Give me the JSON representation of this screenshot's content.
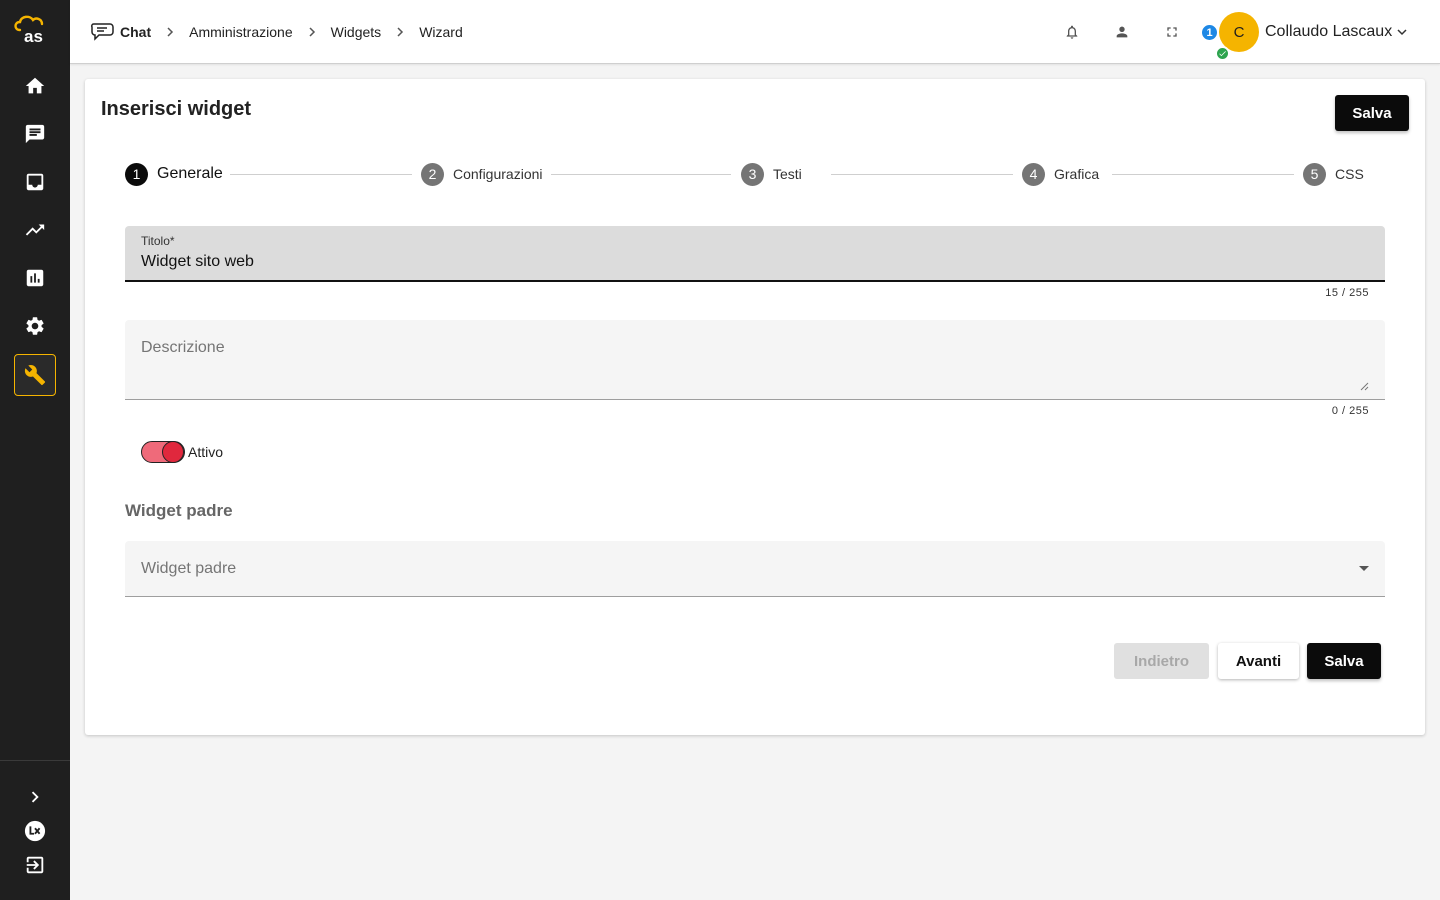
{
  "app": {
    "logo_text": "as",
    "brand_color": "#f5b400",
    "sidebar_bg": "#1f1f1f"
  },
  "sidebar": {
    "items": [
      {
        "icon": "home-icon",
        "active": false
      },
      {
        "icon": "chat-bubble-icon",
        "active": false
      },
      {
        "icon": "inbox-icon",
        "active": false
      },
      {
        "icon": "trending-up-icon",
        "active": false
      },
      {
        "icon": "bar-chart-icon",
        "active": false
      },
      {
        "icon": "gear-icon",
        "active": false
      },
      {
        "icon": "wrench-icon",
        "active": true
      }
    ],
    "bottom": [
      {
        "icon": "chevron-right-icon"
      },
      {
        "icon": "lx-logo-icon"
      },
      {
        "icon": "logout-icon"
      }
    ]
  },
  "breadcrumb": {
    "items": [
      "Chat",
      "Amministrazione",
      "Widgets",
      "Wizard"
    ]
  },
  "header": {
    "user_count": "1",
    "avatar_initial": "C",
    "user_name": "Collaudo Lascaux"
  },
  "card": {
    "title": "Inserisci widget",
    "save_label": "Salva"
  },
  "stepper": {
    "steps": [
      {
        "num": "1",
        "label": "Generale",
        "active": true
      },
      {
        "num": "2",
        "label": "Configurazioni",
        "active": false
      },
      {
        "num": "3",
        "label": "Testi",
        "active": false
      },
      {
        "num": "4",
        "label": "Grafica",
        "active": false
      },
      {
        "num": "5",
        "label": "CSS",
        "active": false
      }
    ]
  },
  "form": {
    "title_label": "Titolo*",
    "title_value": "Widget sito web",
    "title_counter": "15 / 255",
    "description_placeholder": "Descrizione",
    "description_counter": "0 / 255",
    "active_label": "Attivo",
    "active_on": true,
    "parent_section": "Widget padre",
    "parent_placeholder": "Widget padre"
  },
  "actions": {
    "back_label": "Indietro",
    "next_label": "Avanti",
    "save_label": "Salva"
  }
}
